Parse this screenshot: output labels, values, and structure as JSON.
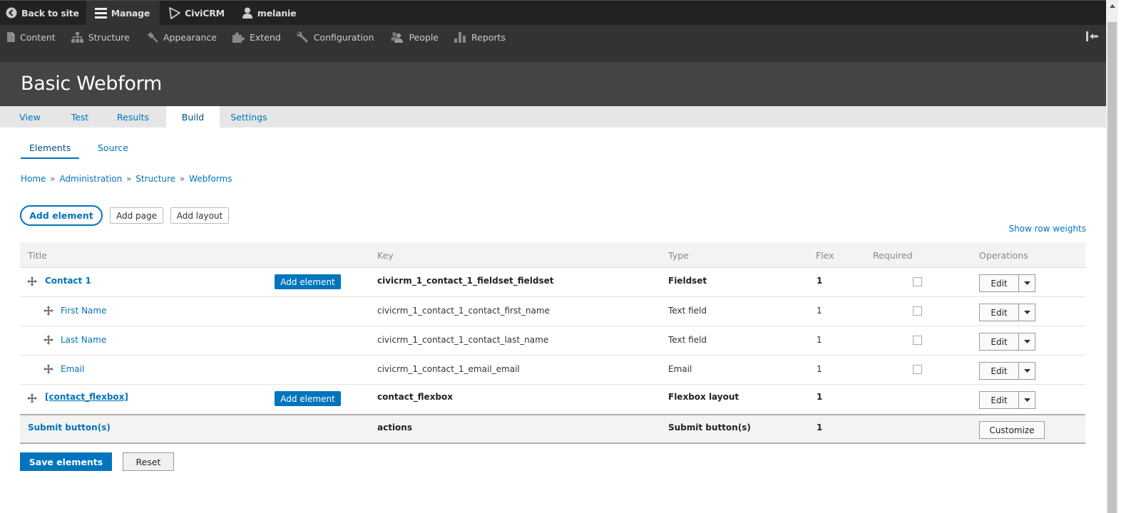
{
  "toolbar": {
    "items": [
      {
        "label": "Back to site",
        "icon": "back-circle-icon"
      },
      {
        "label": "Manage",
        "icon": "hamburger-icon"
      },
      {
        "label": "CiviCRM",
        "icon": "civicrm-triangle-icon"
      },
      {
        "label": "melanie",
        "icon": "user-icon"
      }
    ],
    "tray": [
      {
        "label": "Content",
        "icon": "file-icon"
      },
      {
        "label": "Structure",
        "icon": "hierarchy-icon"
      },
      {
        "label": "Appearance",
        "icon": "paintbrush-icon"
      },
      {
        "label": "Extend",
        "icon": "puzzle-icon"
      },
      {
        "label": "Configuration",
        "icon": "wrench-icon"
      },
      {
        "label": "People",
        "icon": "people-icon"
      },
      {
        "label": "Reports",
        "icon": "bar-chart-icon"
      }
    ],
    "collapse_icon": "collapse-tray-icon"
  },
  "header": {
    "title": "Basic Webform"
  },
  "primary_tabs": [
    {
      "label": "View",
      "active": false
    },
    {
      "label": "Test",
      "active": false
    },
    {
      "label": "Results",
      "active": false
    },
    {
      "label": "Build",
      "active": true
    },
    {
      "label": "Settings",
      "active": false
    }
  ],
  "secondary_tabs": [
    {
      "label": "Elements",
      "active": true
    },
    {
      "label": "Source",
      "active": false
    }
  ],
  "breadcrumb": {
    "items": [
      "Home",
      "Administration",
      "Structure",
      "Webforms"
    ],
    "separator": "»"
  },
  "actions": {
    "add_element": "Add element",
    "add_page": "Add page",
    "add_layout": "Add layout",
    "show_row_weights": "Show row weights"
  },
  "table": {
    "columns": [
      "Title",
      "Key",
      "Type",
      "Flex",
      "Required",
      "Operations"
    ],
    "rows": [
      {
        "title": "Contact 1",
        "key": "civicrm_1_contact_1_fieldset_fieldset",
        "type": "Fieldset",
        "flex": "1",
        "required": false,
        "add_element": "Add element",
        "operation": "Edit"
      },
      {
        "title": "First Name",
        "key": "civicrm_1_contact_1_contact_first_name",
        "type": "Text field",
        "flex": "1",
        "required": false,
        "operation": "Edit"
      },
      {
        "title": "Last Name",
        "key": "civicrm_1_contact_1_contact_last_name",
        "type": "Text field",
        "flex": "1",
        "required": false,
        "operation": "Edit"
      },
      {
        "title": "Email",
        "key": "civicrm_1_contact_1_email_email",
        "type": "Email",
        "flex": "1",
        "required": false,
        "operation": "Edit"
      },
      {
        "title": "[contact_flexbox]",
        "key": "contact_flexbox",
        "type": "Flexbox layout",
        "flex": "1",
        "add_element": "Add element",
        "operation": "Edit"
      },
      {
        "title": "Submit button(s)",
        "key": "actions",
        "type": "Submit button(s)",
        "flex": "1",
        "operation": "Customize"
      }
    ]
  },
  "footer": {
    "save": "Save elements",
    "reset": "Reset"
  },
  "colors": {
    "accent": "#0074bd",
    "toolbar_bg": "#222222",
    "tray_bg": "#333333",
    "header_bg": "#444444"
  }
}
